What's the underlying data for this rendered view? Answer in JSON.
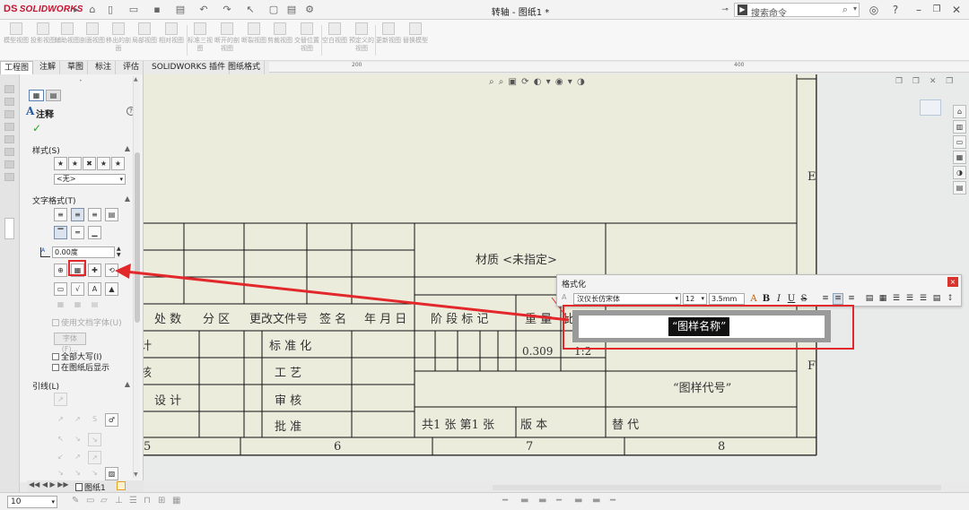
{
  "app": {
    "logo_mark": "DS",
    "logo_text": "SOLIDWORKS",
    "window_title": "转轴 - 图纸1 *",
    "command_search_placeholder": "搜索命令"
  },
  "ribbon": {
    "buttons": [
      "模型视图",
      "投影视图",
      "辅助视图",
      "剖面视图",
      "移出的剖面",
      "局部视图",
      "相对视图",
      "标准三视图",
      "断开的剖视图",
      "断裂视图",
      "剪裁视图",
      "交替位置视图",
      "空白视图",
      "预定义的视图",
      "更新视图",
      "替换模型"
    ]
  },
  "tabs": [
    "工程图",
    "注解",
    "草图",
    "标注",
    "评估",
    "SOLIDWORKS 插件",
    "图纸格式"
  ],
  "ruler": {
    "labels": [
      "200",
      "400"
    ]
  },
  "pm": {
    "title": "注释",
    "help": "?",
    "ok": "✓",
    "style_section": "样式(S)",
    "style_value": "<无>",
    "text_format_section": "文字格式(T)",
    "angle_value": "0.00度",
    "use_doc_font": "使用文档字体(U)",
    "font_button": "字体(F)...",
    "all_caps": "全部大写(I)",
    "behind_sheet": "在图纸后显示",
    "leader_section": "引线(L)"
  },
  "titleblock": {
    "material": "材质 <未指定>",
    "header_row": [
      "处 数",
      "分 区",
      "更改文件号",
      "签 名",
      "年 月 日"
    ],
    "stage_mark": "阶 段 标 记",
    "weight": "重 量",
    "scale": "比 例",
    "weight_value": "0.309",
    "scale_value": "1:2",
    "standardize": "标 准 化",
    "process": "工 艺",
    "review": "审 核",
    "approve": "批 准",
    "design_label": "设 计",
    "review_prefix": "核",
    "design_prefix": "计",
    "drawing_no": "“图样代号”",
    "sheet_info": "共1 张 第1 张",
    "version": "版 本",
    "replace": "替 代",
    "zone_E": "E",
    "zone_F": "F",
    "columns": [
      "5",
      "6",
      "7",
      "8"
    ]
  },
  "format_toolbar": {
    "title": "格式化",
    "font": "汉仪长仿宋体",
    "size": "12",
    "height": "3.5mm",
    "bold": "B",
    "italic": "I",
    "underline": "U",
    "strike": "S",
    "close": "×",
    "angle_glyph": "A"
  },
  "note": {
    "text": "“图样名称”"
  },
  "status": {
    "zoom": "10",
    "sheet_tab": "图纸1"
  }
}
